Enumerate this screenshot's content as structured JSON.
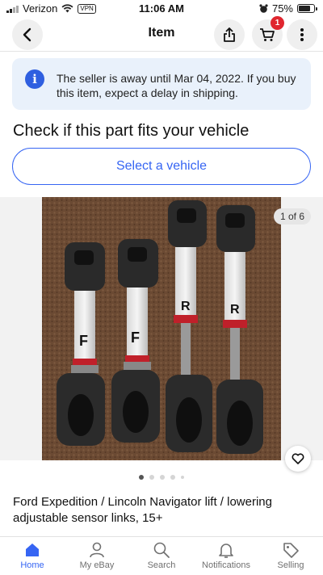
{
  "status_bar": {
    "carrier": "Verizon",
    "vpn": "VPN",
    "time": "11:06 AM",
    "battery": "75%"
  },
  "header": {
    "title": "Item",
    "cart_count": "1"
  },
  "notice": {
    "text": "The seller is away until Mar 04, 2022. If you buy this item, expect a delay in shipping."
  },
  "fitment": {
    "title": "Check if this part fits your vehicle",
    "button": "Select a vehicle"
  },
  "gallery": {
    "counter": "1 of 6",
    "labels": [
      "F",
      "F",
      "R",
      "R"
    ]
  },
  "item": {
    "title": "Ford Expedition / Lincoln Navigator lift / lowering adjustable sensor links, 15+"
  },
  "tabs": [
    {
      "label": "Home",
      "icon": "home-icon",
      "active": true
    },
    {
      "label": "My eBay",
      "icon": "person-icon",
      "active": false
    },
    {
      "label": "Search",
      "icon": "search-icon",
      "active": false
    },
    {
      "label": "Notifications",
      "icon": "bell-icon",
      "active": false
    },
    {
      "label": "Selling",
      "icon": "tag-icon",
      "active": false
    }
  ],
  "colors": {
    "accent": "#3665f3",
    "badge": "#e0262f",
    "notice_bg": "#e9f1fb"
  }
}
